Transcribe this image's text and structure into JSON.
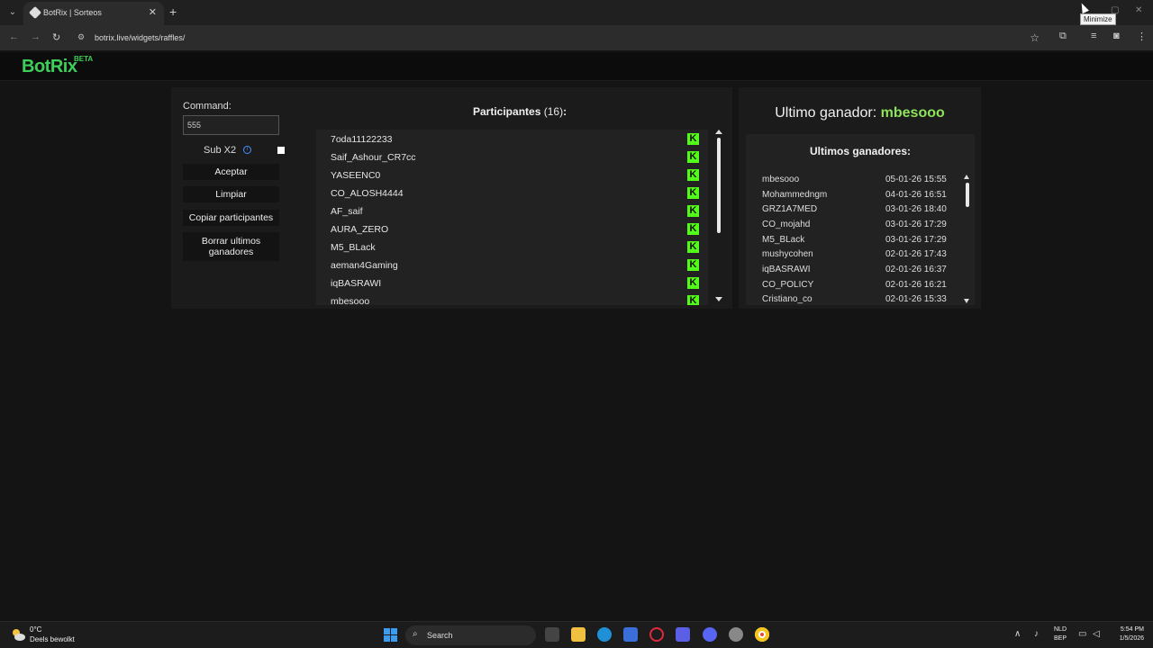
{
  "browser": {
    "tab_title": "BotRix | Sorteos",
    "url": "botrix.live/widgets/raffles/",
    "tooltip": "Minimize"
  },
  "app": {
    "logo": "BotRix",
    "beta": "BETA"
  },
  "controls": {
    "command_label": "Command:",
    "command_value": "555",
    "sub_label": "Sub X2",
    "sub_checked": false,
    "buttons": [
      "Aceptar",
      "Limpiar",
      "Copiar participantes",
      "Borrar ultimos ganadores"
    ]
  },
  "participants": {
    "title": "Participantes",
    "count": "(16)",
    "colon": ":",
    "list": [
      "7oda11122233",
      "Saif_Ashour_CR7cc",
      "YASEENC0",
      "CO_ALOSH4444",
      "AF_saif",
      "AURA_ZERO",
      "M5_BLack",
      "aeman4Gaming",
      "iqBASRAWI",
      "mbesooo"
    ]
  },
  "winner": {
    "label": "Ultimo ganador:",
    "name": "mbesooo"
  },
  "last_winners": {
    "title": "Ultimos ganadores:",
    "rows": [
      {
        "name": "mbesooo",
        "date": "05-01-26 15:55"
      },
      {
        "name": "Mohammedngm",
        "date": "04-01-26 16:51"
      },
      {
        "name": "GRZ1A7MED",
        "date": "03-01-26 18:40"
      },
      {
        "name": "CO_mojahd",
        "date": "03-01-26 17:29"
      },
      {
        "name": "M5_BLack",
        "date": "03-01-26 17:29"
      },
      {
        "name": "mushycohen",
        "date": "02-01-26 17:43"
      },
      {
        "name": "iqBASRAWI",
        "date": "02-01-26 16:37"
      },
      {
        "name": "CO_POLICY",
        "date": "02-01-26 16:21"
      },
      {
        "name": "Cristiano_co",
        "date": "02-01-26 15:33"
      }
    ]
  },
  "taskbar": {
    "temp": "0°C",
    "weather": "Deels bewolkt",
    "search": "Search",
    "lang1": "NLD",
    "lang2": "BEP",
    "time": "5:54 PM",
    "date": "1/5/2026"
  },
  "colors": {
    "brand": "#3ecf5a",
    "kick": "#53fc18",
    "winner": "#8ee35a"
  }
}
